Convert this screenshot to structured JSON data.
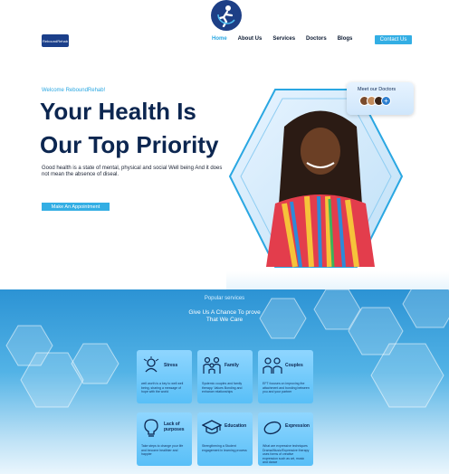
{
  "header": {
    "brand_text": "ReboundRehab",
    "nav": [
      {
        "label": "Home",
        "active": true
      },
      {
        "label": "About Us"
      },
      {
        "label": "Services"
      },
      {
        "label": "Doctors"
      },
      {
        "label": "Blogs"
      }
    ],
    "contact_label": "Contact Us"
  },
  "hero": {
    "welcome": "Welcome ReboundRehab!",
    "title_line1": "Your Health Is",
    "title_line2": "Our Top Priority",
    "description": "Good health is a state of mental, physical and social Well being And it does not mean the absence of diseal.",
    "cta_label": "Make An Appointment"
  },
  "meet_doctors": {
    "label": "Meet our Doctors",
    "plus": "+"
  },
  "services": {
    "eyebrow": "Popular services",
    "title": "Give Us A Chance To prove That We Care",
    "cards": [
      {
        "title": "Stress",
        "desc": "well worth is a key to well well being, sharing a message of hope with the world",
        "icon": "stress-icon"
      },
      {
        "title": "Family",
        "desc": "Systemic couples and family therapy. Values Bonding and enhance relationships",
        "icon": "family-icon"
      },
      {
        "title": "Couples",
        "desc": "EFT focuses on improving the attachment and bonding between you and your partner",
        "icon": "couples-icon"
      },
      {
        "title": "Lack of purposes",
        "desc": "Take steps to change your life and become healthier and happier",
        "icon": "lightbulb-icon"
      },
      {
        "title": "Education",
        "desc": "Strengthening a Student engagement in learning process",
        "icon": "graduation-cap-icon"
      },
      {
        "title": "Expression",
        "desc": "What are expressive techniques Drama/Music/Expressive therapy uses forms of creative expression such as art, music and dance",
        "icon": "expression-icon"
      }
    ]
  },
  "colors": {
    "accent": "#33aee4",
    "title": "#0c2650",
    "band": "#2c93d4"
  }
}
